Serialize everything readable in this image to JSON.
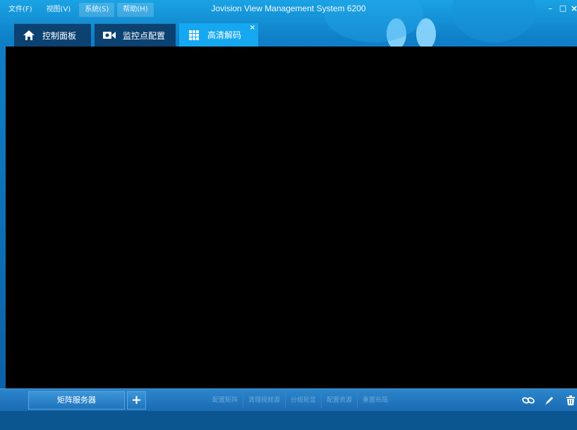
{
  "menu": {
    "file": "文件(F)",
    "view": "视图(V)",
    "system": "系统(S)",
    "help": "帮助(H)"
  },
  "window": {
    "title": "Jovision View Management System 6200",
    "minimize": "–",
    "maximize": "□",
    "close": "×"
  },
  "tabs": [
    {
      "label": "控制面板",
      "icon": "home-icon",
      "active": false
    },
    {
      "label": "监控点配置",
      "icon": "camera-icon",
      "active": false
    },
    {
      "label": "高清解码",
      "icon": "grid-icon",
      "active": true
    }
  ],
  "tab_close": "×",
  "toolbar": {
    "matrix_server": "矩阵服务器",
    "add": "+",
    "buttons": [
      "配置矩阵",
      "清理视频源",
      "分组轮显",
      "配置资源",
      "重置布局"
    ],
    "icons": [
      "link-icon",
      "edit-icon",
      "delete-icon"
    ]
  },
  "colors": {
    "accent": "#15a8f0",
    "background": "#0b5da3",
    "view": "#000000"
  }
}
